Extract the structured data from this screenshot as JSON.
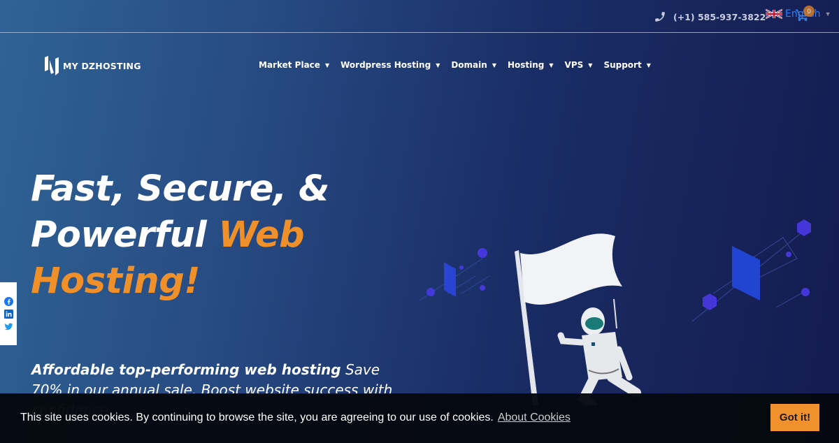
{
  "topbar": {
    "phone_icon": "phone-icon",
    "phone": "(+1) 585-937-3822",
    "language": {
      "flag": "uk-flag-icon",
      "label": "English"
    },
    "cart": {
      "icon": "cart-icon",
      "count": "0"
    }
  },
  "brand": {
    "logo_text": "MY DZHOSTING"
  },
  "nav": {
    "items": [
      {
        "label": "Market Place",
        "caret": "▾"
      },
      {
        "label": "Wordpress Hosting",
        "caret": "▾"
      },
      {
        "label": "Domain",
        "caret": "▾"
      },
      {
        "label": "Hosting",
        "caret": "▾"
      },
      {
        "label": "VPS",
        "caret": "▾"
      },
      {
        "label": "Support",
        "caret": "▾"
      }
    ]
  },
  "hero": {
    "title_line1": "Fast, Secure, &",
    "title_line2_white": "Powerful ",
    "title_line2_orange": "Web",
    "title_line3_orange": "Hosting!",
    "subtitle_bold": "Affordable top-performing web hosting",
    "subtitle_rest": " Save 70% in our annual sale. Boost website success with confidence",
    "accent_color": "#f0902a"
  },
  "social": {
    "items": [
      {
        "name": "facebook-icon"
      },
      {
        "name": "linkedin-icon"
      },
      {
        "name": "twitter-icon"
      }
    ]
  },
  "cookie": {
    "message": "This site uses cookies. By continuing to browse the site, you are agreeing to our use of cookies.",
    "link_label": "About Cookies",
    "button_label": "Got it!",
    "button_color": "#f0912e"
  }
}
